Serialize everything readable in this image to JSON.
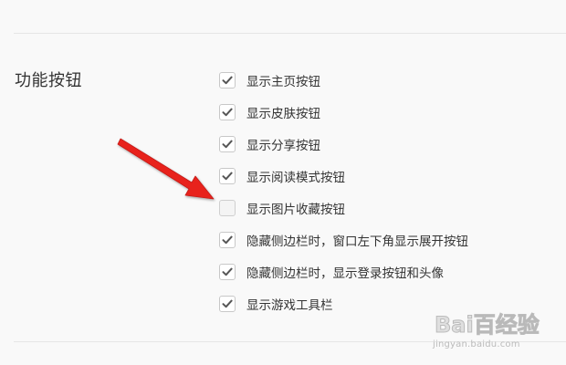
{
  "section": {
    "label": "功能按钮"
  },
  "options": [
    {
      "label": "显示主页按钮",
      "checked": true
    },
    {
      "label": "显示皮肤按钮",
      "checked": true
    },
    {
      "label": "显示分享按钮",
      "checked": true
    },
    {
      "label": "显示阅读模式按钮",
      "checked": true
    },
    {
      "label": "显示图片收藏按钮",
      "checked": false
    },
    {
      "label": "隐藏侧边栏时，窗口左下角显示展开按钮",
      "checked": true
    },
    {
      "label": "隐藏侧边栏时，显示登录按钮和头像",
      "checked": true
    },
    {
      "label": "显示游戏工具栏",
      "checked": true
    }
  ],
  "watermark": {
    "logo": "Bai百经验",
    "url": "jingyan.baidu.com"
  },
  "colors": {
    "arrow": "#e8231f",
    "check": "#555555",
    "background": "#f9f9f9"
  },
  "icons": {
    "check": "check-icon",
    "arrow": "red-arrow-icon"
  }
}
